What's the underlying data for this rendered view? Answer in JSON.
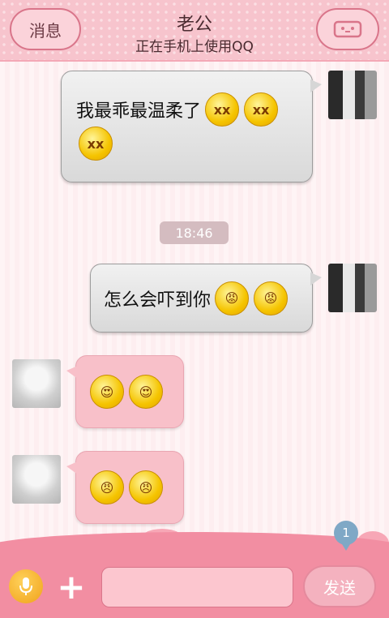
{
  "header": {
    "back_label": "消息",
    "title": "老公",
    "subtitle": "正在手机上使用QQ",
    "menu_icon": "profile-icon"
  },
  "messages": [
    {
      "side": "right",
      "text": "我最乖最温柔了",
      "emojis": [
        "ⅹⅹ",
        "ⅹⅹ",
        "ⅹⅹ"
      ]
    },
    {
      "side": "right",
      "text": "怎么会吓到你",
      "emojis": [
        "😡",
        "😡"
      ]
    },
    {
      "side": "left",
      "text": "",
      "emojis": [
        "😍",
        "😍"
      ]
    },
    {
      "side": "left",
      "text": "",
      "emojis": [
        "😠",
        "😠"
      ]
    }
  ],
  "timestamp": "18:46",
  "input": {
    "value": "",
    "placeholder": ""
  },
  "send_label": "发送",
  "badge_count": "1",
  "colors": {
    "header": "#f7c4cd",
    "bottom": "#f28ea2",
    "bubble_left": "#f8c0c9",
    "bubble_right": "#e0e0e0"
  }
}
